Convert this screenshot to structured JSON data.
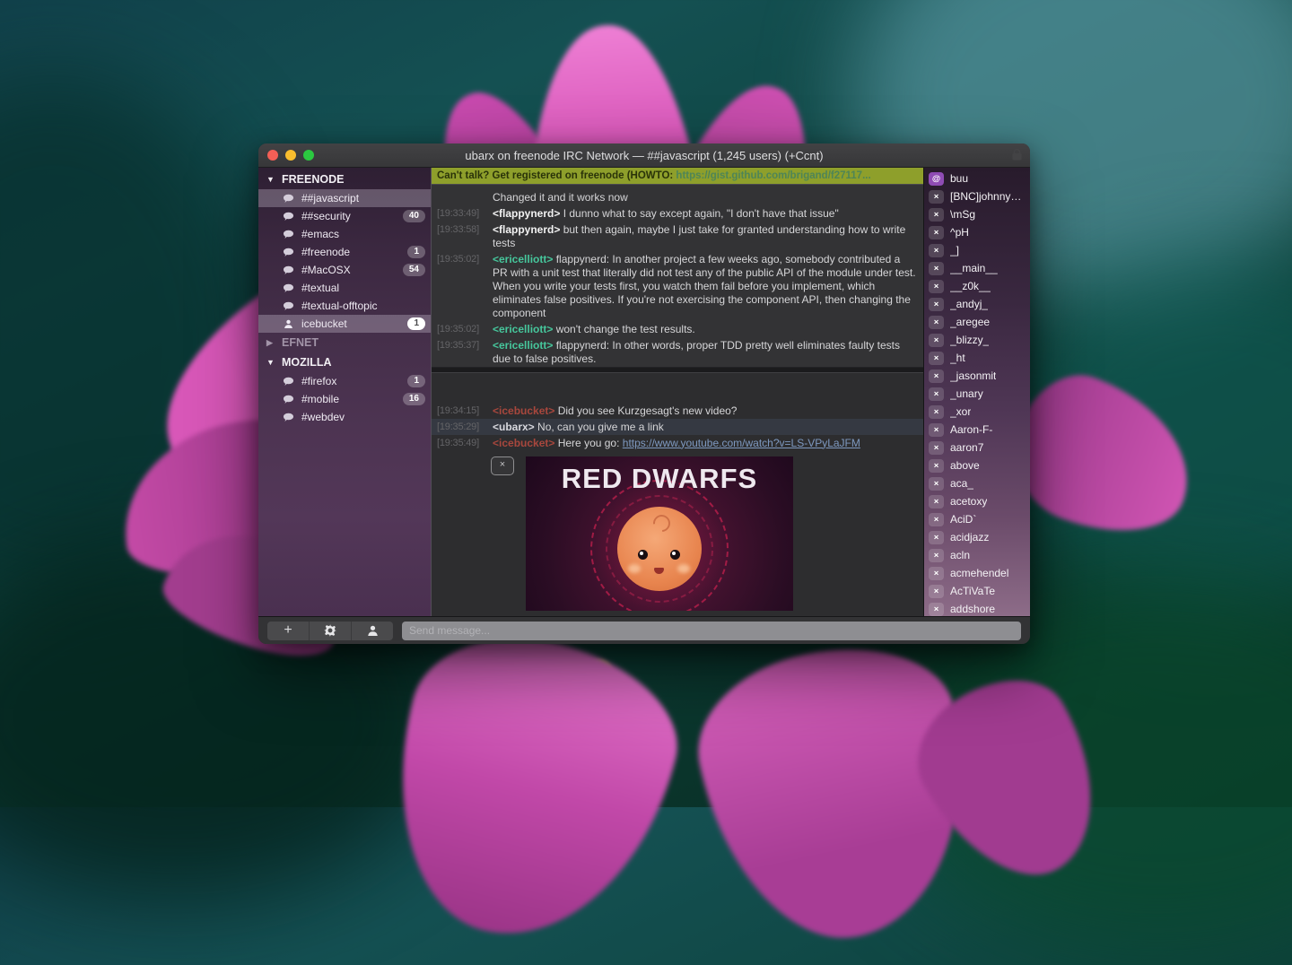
{
  "window": {
    "title": "ubarx on freenode IRC Network — ##javascript (1,245 users) (+Ccnt)"
  },
  "topic": {
    "text": "Can't talk? Get registered on freenode (HOWTO: ",
    "link": "https://gist.github.com/brigand/f27117..."
  },
  "colors": {
    "topic_bg": "#8e9f2b",
    "op_badge": "#8f4cb4",
    "nicks": {
      "flappynerd": "#f2f2f2",
      "ericelliott": "#46c79c",
      "icebucket": "#a8473d",
      "ubarx": "#d8d8de"
    }
  },
  "sidebar": {
    "sections": [
      {
        "name": "FREENODE",
        "expanded": true,
        "items": [
          {
            "label": "##javascript",
            "type": "channel",
            "selected": true
          },
          {
            "label": "##security",
            "type": "channel",
            "badge": "40"
          },
          {
            "label": "#emacs",
            "type": "channel"
          },
          {
            "label": "#freenode",
            "type": "channel",
            "badge": "1"
          },
          {
            "label": "#MacOSX",
            "type": "channel",
            "badge": "54"
          },
          {
            "label": "#textual",
            "type": "channel"
          },
          {
            "label": "#textual-offtopic",
            "type": "channel"
          },
          {
            "label": "icebucket",
            "type": "user",
            "badge": "1",
            "selected": true
          }
        ]
      },
      {
        "name": "EFNET",
        "expanded": false,
        "items": []
      },
      {
        "name": "MOZILLA",
        "expanded": true,
        "items": [
          {
            "label": "#firefox",
            "type": "channel",
            "badge": "1"
          },
          {
            "label": "#mobile",
            "type": "channel",
            "badge": "16"
          },
          {
            "label": "#webdev",
            "type": "channel"
          }
        ]
      }
    ]
  },
  "chat": {
    "top": {
      "messages": [
        {
          "time": "",
          "nick": null,
          "text": "Changed it and it works now"
        },
        {
          "time": "[19:33:49]",
          "nick": "flappynerd",
          "text": "I dunno what to say except again, \"I don't have that issue\""
        },
        {
          "time": "[19:33:58]",
          "nick": "flappynerd",
          "text": "but then again, maybe I just take for granted understanding how to write tests"
        },
        {
          "time": "[19:35:02]",
          "nick": "ericelliott",
          "text": "flappynerd: In another project a few weeks ago, somebody contributed a PR with a unit test that literally did not test any of the public API of the module under test. When you write your tests first, you watch them fail before you implement, which eliminates false positives. If you're not exercising the component API, then changing the component"
        },
        {
          "time": "[19:35:02]",
          "nick": "ericelliott",
          "text": "won't change the test results."
        },
        {
          "time": "[19:35:37]",
          "nick": "ericelliott",
          "text": "flappynerd: In other words, proper TDD pretty well eliminates faulty tests due to false positives."
        }
      ]
    },
    "bottom": {
      "messages": [
        {
          "time": "[19:34:15]",
          "nick": "icebucket",
          "text": "Did you see Kurzgesagt's new video?"
        },
        {
          "time": "[19:35:29]",
          "nick": "ubarx",
          "text": "No, can you give me a link",
          "highlight": true
        },
        {
          "time": "[19:35:49]",
          "nick": "icebucket",
          "text": "Here you go: ",
          "link": "https://www.youtube.com/watch?v=LS-VPyLaJFM"
        }
      ],
      "preview": {
        "title": "RED DWARFS",
        "close_label": "×"
      }
    }
  },
  "userlist": {
    "users": [
      {
        "mode": "@",
        "name": "buu"
      },
      {
        "mode": "×",
        "name": "[BNC]johnny…"
      },
      {
        "mode": "×",
        "name": "\\mSg"
      },
      {
        "mode": "×",
        "name": "^pH"
      },
      {
        "mode": "×",
        "name": "_]"
      },
      {
        "mode": "×",
        "name": "__main__"
      },
      {
        "mode": "×",
        "name": "__z0k__"
      },
      {
        "mode": "×",
        "name": "_andyj_"
      },
      {
        "mode": "×",
        "name": "_aregee"
      },
      {
        "mode": "×",
        "name": "_blizzy_"
      },
      {
        "mode": "×",
        "name": "_ht"
      },
      {
        "mode": "×",
        "name": "_jasonmit"
      },
      {
        "mode": "×",
        "name": "_unary"
      },
      {
        "mode": "×",
        "name": "_xor"
      },
      {
        "mode": "×",
        "name": "Aaron-F-"
      },
      {
        "mode": "×",
        "name": "aaron7"
      },
      {
        "mode": "×",
        "name": "above"
      },
      {
        "mode": "×",
        "name": "aca_"
      },
      {
        "mode": "×",
        "name": "acetoxy"
      },
      {
        "mode": "×",
        "name": "AciD`"
      },
      {
        "mode": "×",
        "name": "acidjazz"
      },
      {
        "mode": "×",
        "name": "acln"
      },
      {
        "mode": "×",
        "name": "acmehendel"
      },
      {
        "mode": "×",
        "name": "AcTiVaTe"
      },
      {
        "mode": "×",
        "name": "addshore"
      }
    ]
  },
  "input": {
    "placeholder": "Send message..."
  }
}
